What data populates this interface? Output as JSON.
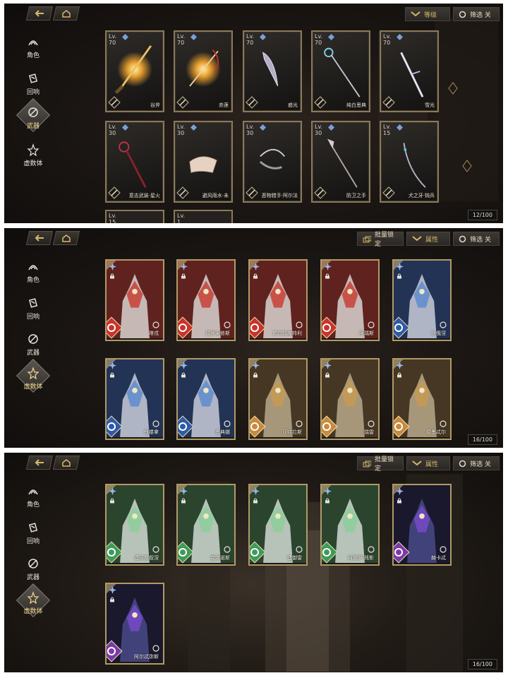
{
  "nav": {
    "back_icon": "back-arrow-icon",
    "home_icon": "home-icon"
  },
  "sidebar": {
    "items": [
      {
        "label": "角色",
        "icon": "character-icon"
      },
      {
        "label": "回响",
        "icon": "echo-icon"
      },
      {
        "label": "武器",
        "icon": "weapon-icon"
      },
      {
        "label": "虚数体",
        "icon": "mech-icon"
      }
    ]
  },
  "panel1": {
    "sort_label": "等级",
    "filter_label": "筛选 关",
    "active_tab": "武器",
    "counter": "12/100",
    "weapons": [
      {
        "lv_label": "Lv.",
        "lv": "70",
        "name": "谷斧"
      },
      {
        "lv_label": "Lv.",
        "lv": "70",
        "name": "赤莲"
      },
      {
        "lv_label": "Lv.",
        "lv": "70",
        "name": "惑光"
      },
      {
        "lv_label": "Lv.",
        "lv": "70",
        "name": "纯白思典"
      },
      {
        "lv_label": "Lv.",
        "lv": "70",
        "name": "雪光"
      },
      {
        "lv_label": "Lv.",
        "lv": "30",
        "name": "意志武装·星火"
      },
      {
        "lv_label": "Lv.",
        "lv": "30",
        "name": "避风雨水·未"
      },
      {
        "lv_label": "Lv.",
        "lv": "30",
        "name": "恶物猎手·阿尔法"
      },
      {
        "lv_label": "Lv.",
        "lv": "30",
        "name": "防卫之手"
      },
      {
        "lv_label": "Lv.",
        "lv": "15",
        "name": "犬之牙·钝兵"
      }
    ],
    "peek": [
      {
        "lv_label": "Lv.",
        "lv": "15"
      },
      {
        "lv_label": "Lv.",
        "lv": "1"
      }
    ]
  },
  "panel2": {
    "batch_lock_label": "批量锁定",
    "sort_label": "属性",
    "filter_label": "筛选 关",
    "active_tab": "虚数体",
    "counter": "16/100",
    "units": [
      {
        "name": "喀戎",
        "element": "fire"
      },
      {
        "name": "普罗米修斯",
        "element": "fire"
      },
      {
        "name": "希乌特库特利",
        "element": "fire"
      },
      {
        "name": "阿瑞斯",
        "element": "fire"
      },
      {
        "name": "狄俄涅",
        "element": "water"
      },
      {
        "name": "伐楼拿",
        "element": "water"
      },
      {
        "name": "恩典娜",
        "element": "water"
      },
      {
        "name": "亚特拉斯",
        "element": "earth"
      },
      {
        "name": "瑞雷",
        "element": "earth"
      },
      {
        "name": "德墨忒尔",
        "element": "earth"
      }
    ]
  },
  "panel3": {
    "batch_lock_label": "批量锁定",
    "sort_label": "属性",
    "filter_label": "筛选 关",
    "active_tab": "虚数体",
    "counter": "16/100",
    "units": [
      {
        "name": "谟涅摩叙涅",
        "element": "wind"
      },
      {
        "name": "克洛诺斯",
        "element": "wind"
      },
      {
        "name": "建御雷",
        "element": "wind"
      },
      {
        "name": "阿波罗·残影",
        "element": "wind"
      },
      {
        "name": "赫卡忒",
        "element": "void"
      },
      {
        "name": "阿尔忒弥斯",
        "element": "void"
      }
    ]
  },
  "colors": {
    "fire": "#c8342c",
    "water": "#2f5aa8",
    "earth": "#c98a3c",
    "wind": "#3f9a5a",
    "void": "#7a3aa8",
    "frame_gold": "#b09a68"
  }
}
